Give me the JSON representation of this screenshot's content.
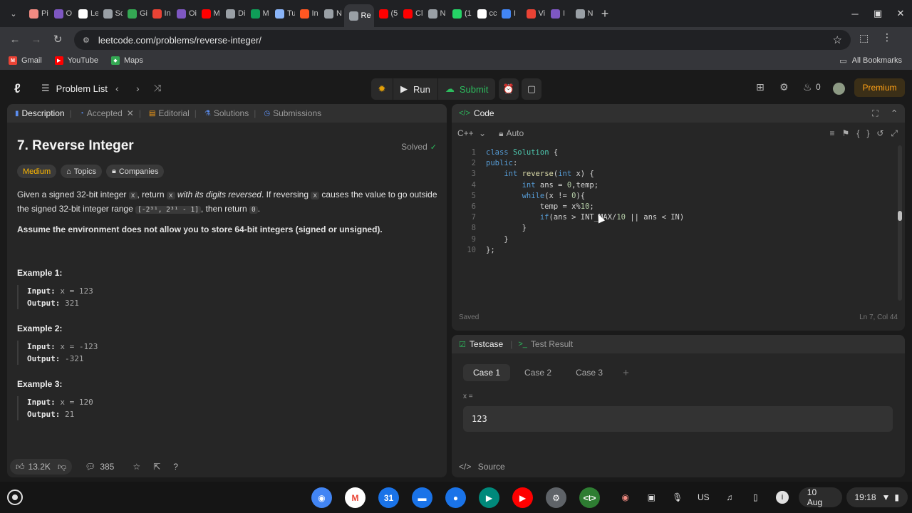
{
  "browser": {
    "tabs": [
      {
        "label": "Pi",
        "fav": "#f28b82"
      },
      {
        "label": "O",
        "fav": "#7e57c2"
      },
      {
        "label": "Le",
        "fav": "#ffffff"
      },
      {
        "label": "Sc",
        "fav": "#9aa0a6"
      },
      {
        "label": "Gi",
        "fav": "#34a853"
      },
      {
        "label": "In",
        "fav": "#ea4335"
      },
      {
        "label": "Oi",
        "fav": "#7e57c2"
      },
      {
        "label": "M",
        "fav": "#ff0000"
      },
      {
        "label": "Di",
        "fav": "#9aa0a6"
      },
      {
        "label": "M",
        "fav": "#0f9d58"
      },
      {
        "label": "Tu",
        "fav": "#8ab4f8"
      },
      {
        "label": "In",
        "fav": "#ff5722"
      },
      {
        "label": "N",
        "fav": "#9aa0a6"
      },
      {
        "label": "Re",
        "fav": "#9aa0a6",
        "active": true
      },
      {
        "label": "(5",
        "fav": "#ff0000"
      },
      {
        "label": "Cl",
        "fav": "#ff0000"
      },
      {
        "label": "N",
        "fav": "#9aa0a6"
      },
      {
        "label": "(1",
        "fav": "#25d366"
      },
      {
        "label": "cc",
        "fav": "#ffffff"
      },
      {
        "label": "I",
        "fav": "#4285f4"
      },
      {
        "label": "Vi",
        "fav": "#ea4335"
      },
      {
        "label": "I",
        "fav": "#7e57c2"
      },
      {
        "label": "N",
        "fav": "#9aa0a6"
      }
    ],
    "url": "leetcode.com/problems/reverse-integer/",
    "bookmarks": [
      {
        "label": "Gmail",
        "color": "#ea4335",
        "glyph": "M"
      },
      {
        "label": "YouTube",
        "color": "#ff0000",
        "glyph": "▶"
      },
      {
        "label": "Maps",
        "color": "#34a853",
        "glyph": "◆"
      }
    ],
    "all_bookmarks": "All Bookmarks"
  },
  "toolbar": {
    "problem_list": "Problem List",
    "run": "Run",
    "submit": "Submit",
    "streak": "0",
    "premium": "Premium"
  },
  "description": {
    "tabs": [
      "Description",
      "Accepted",
      "Editorial",
      "Solutions",
      "Submissions"
    ],
    "title": "7. Reverse Integer",
    "solved": "Solved",
    "tags": [
      "Medium",
      "Topics",
      "Companies"
    ],
    "para1_a": "Given a signed 32-bit integer ",
    "var_x": "x",
    "para1_b": ", return ",
    "para1_c": " with its digits reversed",
    "para1_d": ". If reversing ",
    "para1_e": " causes the value to go outside",
    "para1_f": "the signed 32-bit integer range ",
    "range": "[-2³¹, 2³¹ - 1]",
    "para1_g": ", then return ",
    "zero": "0",
    "para2": "Assume the environment does not allow you to store 64-bit integers (signed or unsigned).",
    "examples": [
      {
        "title": "Example 1:",
        "input": "x = 123",
        "output": "321"
      },
      {
        "title": "Example 2:",
        "input": "x = -123",
        "output": "-321"
      },
      {
        "title": "Example 3:",
        "input": "x = 120",
        "output": "21"
      }
    ],
    "input_label": "Input:",
    "output_label": "Output:",
    "likes": "13.2K",
    "comments": "385"
  },
  "code": {
    "title": "Code",
    "language": "C++",
    "mode": "Auto",
    "lines": [
      "class Solution {",
      "public:",
      "    int reverse(int x) {",
      "        int ans = 0,temp;",
      "        while(x != 0){",
      "            temp = x%10;",
      "            if(ans > INT_MAX/10 || ans < IN)",
      "        }",
      "    }",
      "};"
    ],
    "saved": "Saved",
    "position": "Ln 7, Col 44"
  },
  "testcase": {
    "tab1": "Testcase",
    "tab2": "Test Result",
    "cases": [
      "Case 1",
      "Case 2",
      "Case 3"
    ],
    "var_label": "x =",
    "value": "123",
    "source": "Source"
  },
  "shelf": {
    "apps": [
      {
        "name": "chrome",
        "color": "#4285f4",
        "glyph": "◉"
      },
      {
        "name": "gmail",
        "color": "#ffffff",
        "glyph": "M"
      },
      {
        "name": "calendar",
        "color": "#1a73e8",
        "glyph": "31"
      },
      {
        "name": "files",
        "color": "#1a73e8",
        "glyph": "▬"
      },
      {
        "name": "messages",
        "color": "#1a73e8",
        "glyph": "●"
      },
      {
        "name": "meet",
        "color": "#00897b",
        "glyph": "▶"
      },
      {
        "name": "youtube",
        "color": "#ff0000",
        "glyph": "▶"
      },
      {
        "name": "settings",
        "color": "#5f6368",
        "glyph": "⚙"
      },
      {
        "name": "terminal",
        "color": "#2e7d32",
        "glyph": "<t>"
      }
    ],
    "lang": "US",
    "date": "10 Aug",
    "time": "19:18"
  },
  "colors": {
    "accent": "#ffa116",
    "success": "#2cbb5d",
    "keyword": "#569cd6"
  }
}
